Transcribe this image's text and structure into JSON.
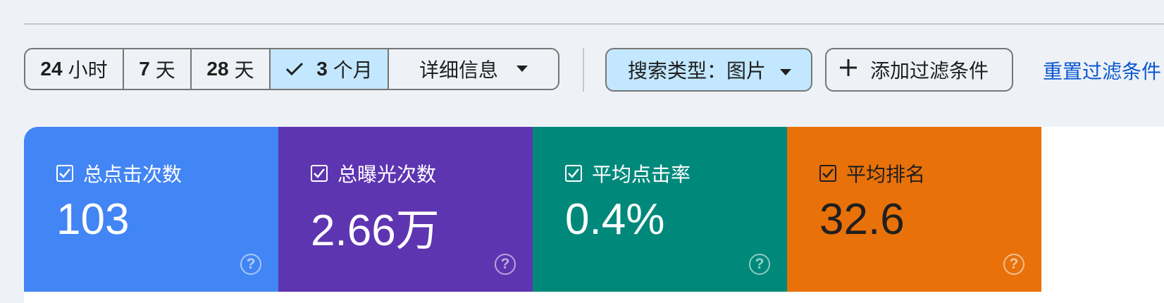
{
  "date_range": {
    "options": [
      {
        "num": "24",
        "unit": "小时"
      },
      {
        "num": "7",
        "unit": "天"
      },
      {
        "num": "28",
        "unit": "天"
      },
      {
        "num": "3",
        "unit": "个月"
      }
    ],
    "selected_index": 3,
    "more_label": "详细信息"
  },
  "filters": {
    "search_type_label": "搜索类型：图片",
    "add_filter_label": "添加过滤条件",
    "reset_label": "重置过滤条件"
  },
  "metrics": [
    {
      "label": "总点击次数",
      "value": "103",
      "color": "#4285f4",
      "checked": true
    },
    {
      "label": "总曝光次数",
      "value": "2.66万",
      "color": "#5e35b1",
      "checked": true
    },
    {
      "label": "平均点击率",
      "value": "0.4%",
      "color": "#00897b",
      "checked": true
    },
    {
      "label": "平均排名",
      "value": "32.6",
      "color": "#e8710a",
      "checked": true
    }
  ],
  "icons": {
    "check": "check-icon",
    "dropdown": "arrow-drop-down-icon",
    "add": "plus-icon",
    "help": "help-icon"
  },
  "help_glyph": "?"
}
